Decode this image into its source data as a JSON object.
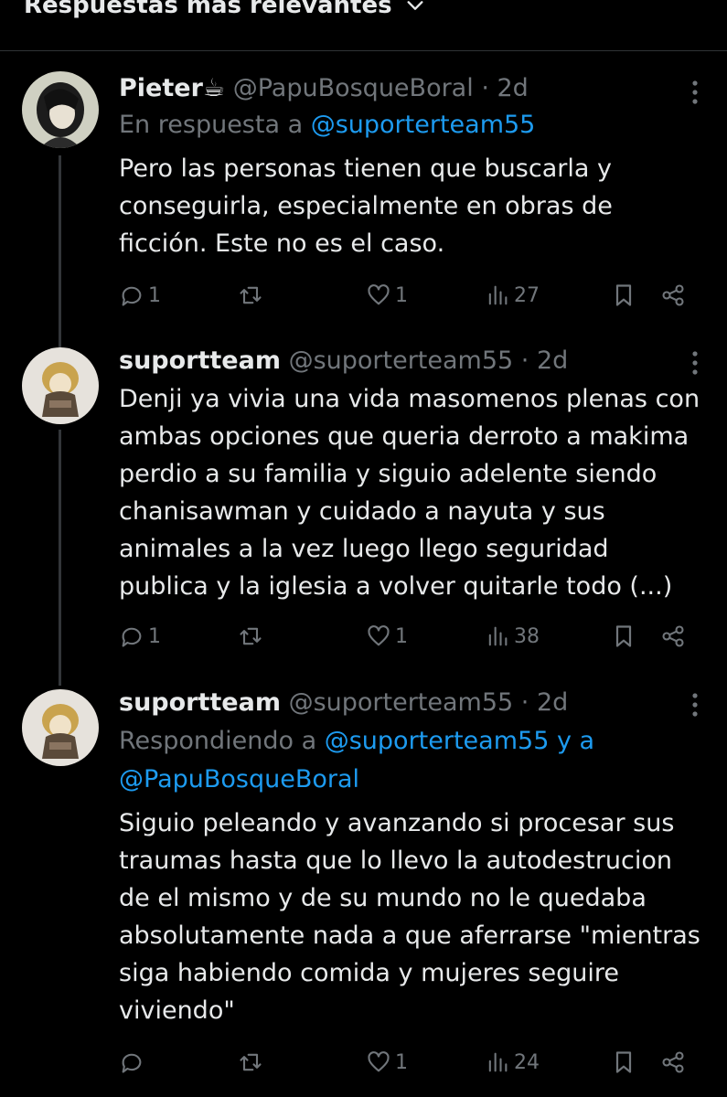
{
  "header": {
    "sort_label": "Respuestas más relevantes"
  },
  "tweets": [
    {
      "name": "Pieter☕",
      "handle": "@PapuBosqueBoral",
      "time": "· 2d",
      "reply_prefix": "En respuesta a ",
      "reply_mention": "@suporterteam55",
      "reply_mention2": "",
      "text": "Pero las personas tienen que buscarla y conseguirla, especialmente en obras de ficción. Este no es el caso.",
      "replies": "1",
      "retweets": "",
      "likes": "1",
      "views": "27"
    },
    {
      "name": "suportteam",
      "handle": "@suporterteam55",
      "time": "· 2d",
      "text": "Denji ya vivia una vida masomenos plenas con ambas opciones que queria derroto a makima perdio a su familia y siguio adelente siendo chanisawman y cuidado a nayuta y sus animales a la vez luego llego seguridad publica y la iglesia a volver quitarle todo (...)",
      "replies": "1",
      "retweets": "",
      "likes": "1",
      "views": "38"
    },
    {
      "name": "suportteam",
      "handle": "@suporterteam55",
      "time": "· 2d",
      "reply_prefix": "Respondiendo a ",
      "reply_mention": "@suporterteam55 y a",
      "reply_mention2": "@PapuBosqueBoral",
      "text": "Siguio peleando y avanzando si procesar sus traumas hasta que lo llevo la autodestrucion de el mismo y de su mundo no le quedaba absolutamente nada a que aferrarse \"mientras siga habiendo comida y mujeres seguire viviendo\"",
      "replies": "",
      "retweets": "",
      "likes": "1",
      "views": "24"
    }
  ]
}
